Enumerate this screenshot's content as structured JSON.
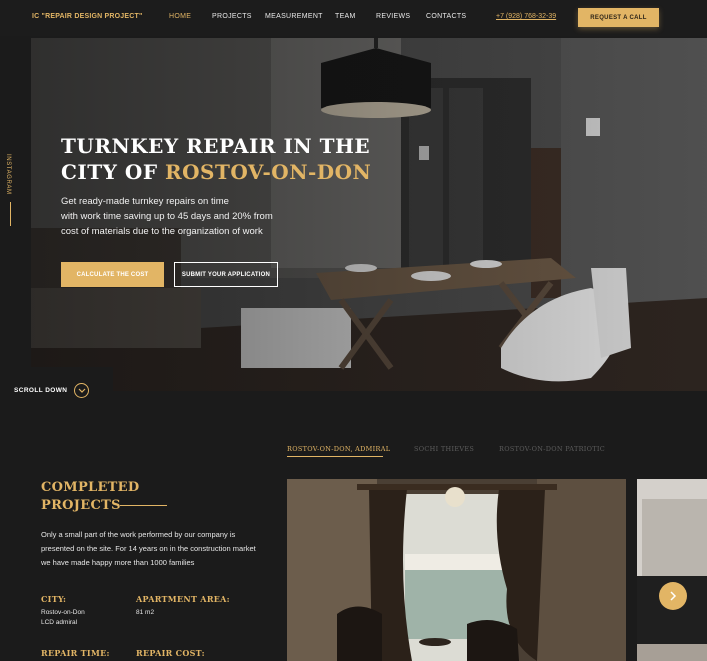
{
  "header": {
    "logo": "IC \"REPAIR DESIGN PROJECT\"",
    "nav": [
      "HOME",
      "PROJECTS",
      "MEASUREMENT",
      "TEAM",
      "REVIEWS",
      "CONTACTS"
    ],
    "active_nav": "HOME",
    "phone": "+7 (928) 768-32-39",
    "request_button": "REQUEST A CALL"
  },
  "sidebar": {
    "instagram": "INSTAGRAM"
  },
  "hero": {
    "title_line1": "TURNKEY REPAIR IN THE",
    "title_line2_prefix": "CITY OF ",
    "title_line2_city": "ROSTOV-ON-DON",
    "subtitle_lines": [
      "Get ready-made turnkey repairs on time",
      "with work time saving up to 45 days and 20% from",
      "cost of materials due to the organization of work"
    ],
    "btn_calculate": "CALCULATE THE COST",
    "btn_submit": "SUBMIT YOUR APPLICATION",
    "scroll_down": "SCROLL DOWN"
  },
  "projects": {
    "tabs": [
      "ROSTOV-ON-DON, ADMIRAL",
      "SOCHI THIEVES",
      "ROSTOV-ON-DON PATRIOTIC"
    ],
    "active_tab": 0,
    "title_line1": "COMPLETED",
    "title_line2": "PROJECTS",
    "description": "Only a small part of the work performed by our company is presented on the site. For 14 years on in the construction market we have made happy more than 1000 families",
    "city_label": "CITY:",
    "city_value_1": "Rostov-on-Don",
    "city_value_2": "LCD admiral",
    "area_label": "APARTMENT AREA:",
    "area_value": "81 m2",
    "time_label": "REPAIR TIME:",
    "cost_label": "REPAIR COST:"
  },
  "colors": {
    "accent": "#e2b565",
    "background": "#1b1b1b"
  }
}
